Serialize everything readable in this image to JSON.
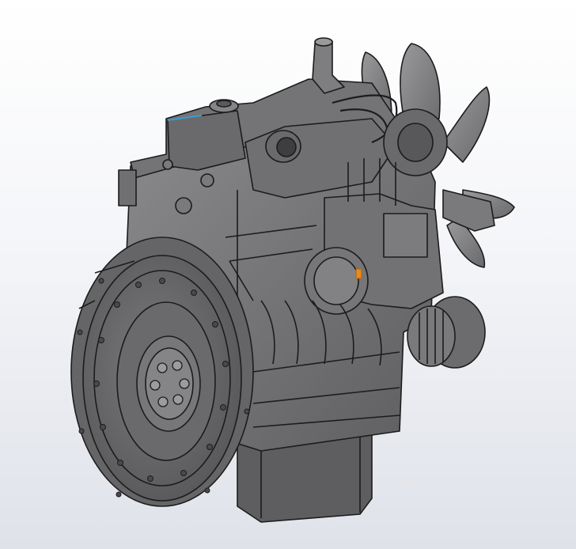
{
  "viewport": {
    "background_top": "#ffffff",
    "background_bottom": "#dfe2e9"
  },
  "model": {
    "subject": "diesel-engine-assembly",
    "body_color": "#6e6e70",
    "dark_color": "#4a4a4c",
    "edge_color": "#1c1c1c",
    "highlight_edge_color": "#3a9fd0",
    "selected_feature_color": "#e58a1f"
  }
}
